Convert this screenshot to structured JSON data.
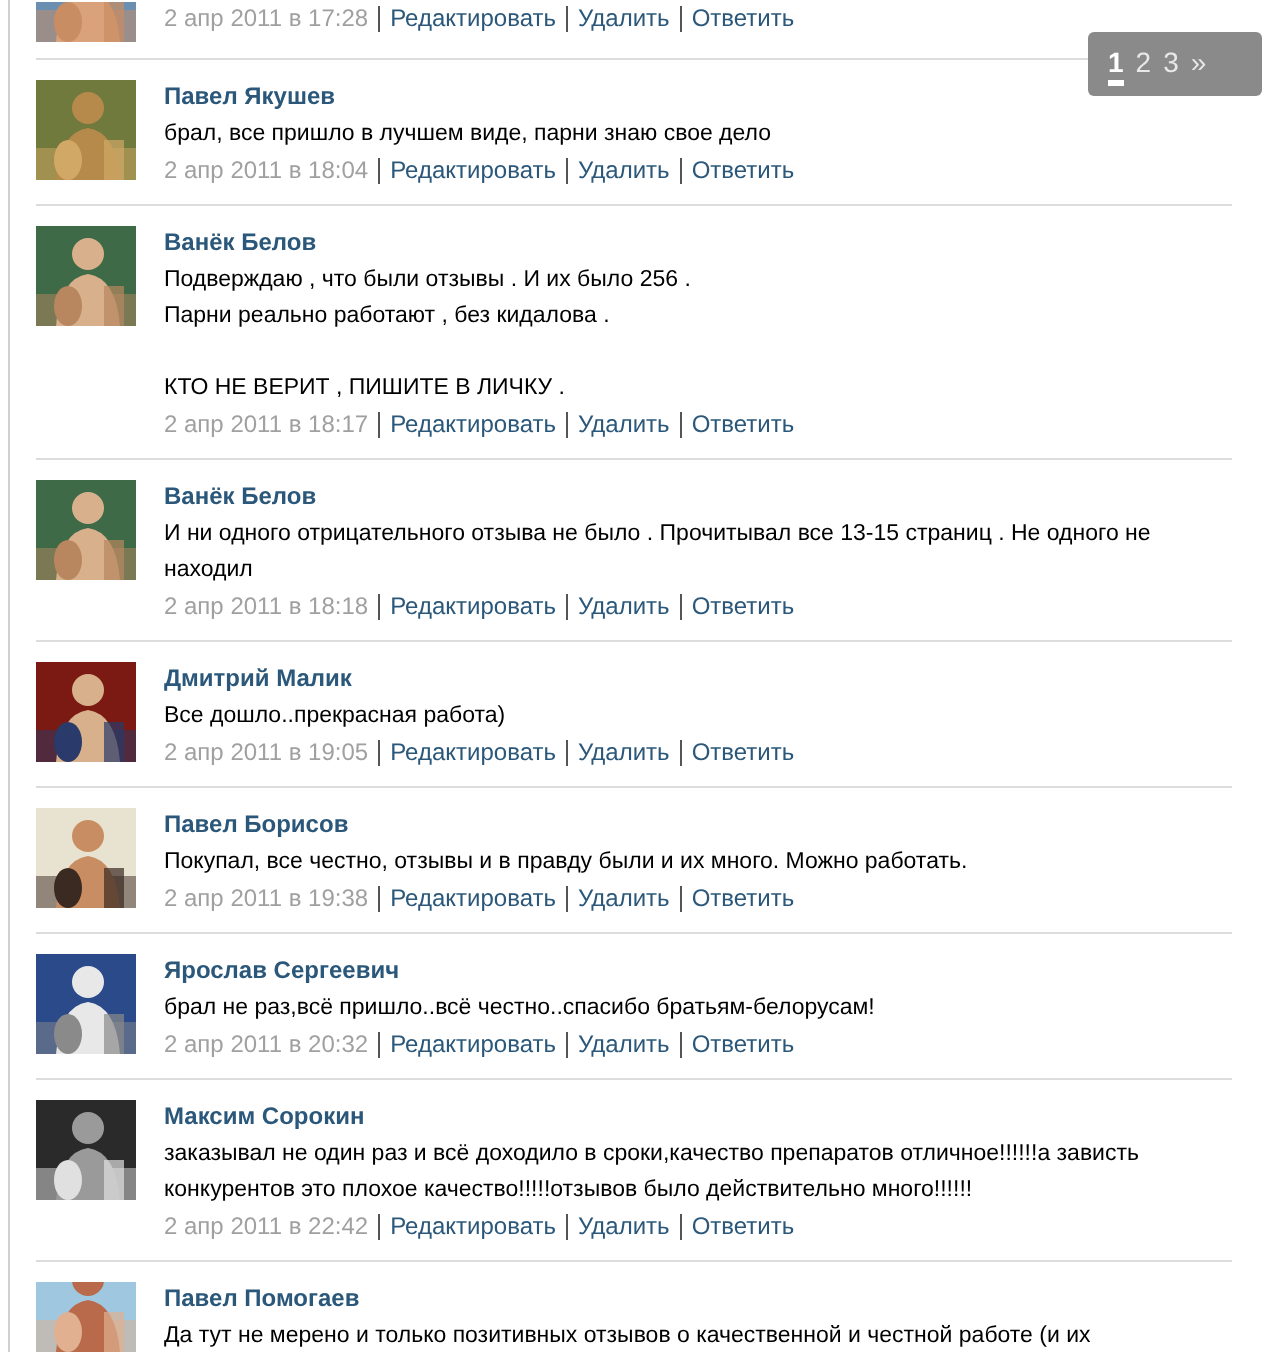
{
  "pagination": [
    {
      "label": "1",
      "selected": true
    },
    {
      "label": "2",
      "selected": false
    },
    {
      "label": "3",
      "selected": false
    },
    {
      "label": "»",
      "selected": false
    }
  ],
  "comments": [
    {
      "kind": "partial",
      "date": "2 апр 2011 в 17:28",
      "actions": [
        "Редактировать",
        "Удалить",
        "Ответить"
      ]
    },
    {
      "kind": "full",
      "author": "Павел Якушев",
      "text": "брал, все пришло в лучшем виде, парни знаю свое дело",
      "date": "2 апр 2011 в 18:04",
      "actions": [
        "Редактировать",
        "Удалить",
        "Ответить"
      ]
    },
    {
      "kind": "full",
      "author": "Ванёк Белов",
      "text": "Подверждаю , что были отзывы . И их было 256 .\nПарни реально работают , без кидалова .\n\nКТО НЕ ВЕРИТ , ПИШИТЕ В ЛИЧКУ .",
      "date": "2 апр 2011 в 18:17",
      "actions": [
        "Редактировать",
        "Удалить",
        "Ответить"
      ]
    },
    {
      "kind": "full",
      "author": "Ванёк Белов",
      "text": "И ни одного отрицательного отзыва не было . Прочитывал все 13-15 страниц . Не одного не находил",
      "date": "2 апр 2011 в 18:18",
      "actions": [
        "Редактировать",
        "Удалить",
        "Ответить"
      ]
    },
    {
      "kind": "full",
      "author": "Дмитрий Малик",
      "text": "Все дошло..прекрасная работа)",
      "date": "2 апр 2011 в 19:05",
      "actions": [
        "Редактировать",
        "Удалить",
        "Ответить"
      ]
    },
    {
      "kind": "full",
      "author": "Павел Борисов",
      "text": "Покупал, все честно, отзывы и в правду были и их много. Можно работать.",
      "date": "2 апр 2011 в 19:38",
      "actions": [
        "Редактировать",
        "Удалить",
        "Ответить"
      ]
    },
    {
      "kind": "full",
      "author": "Ярослав Сергеевич",
      "text": "брал не раз,всё пришло..всё честно..спасибо братьям-белорусам!",
      "date": "2 апр 2011 в 20:32",
      "actions": [
        "Редактировать",
        "Удалить",
        "Ответить"
      ]
    },
    {
      "kind": "full",
      "author": "Максим Сорокин",
      "text": "заказывал не один раз и всё доходило в сроки,качество препаратов отличное!!!!!!а зависть конкурентов это плохое качество!!!!!отзывов было действительно много!!!!!!",
      "date": "2 апр 2011 в 22:42",
      "actions": [
        "Редактировать",
        "Удалить",
        "Ответить"
      ]
    },
    {
      "kind": "cut",
      "author": "Павел Помогаев",
      "text": "Да тут не мерено и только позитивных отзывов о качественной и честной работе (и их"
    }
  ]
}
